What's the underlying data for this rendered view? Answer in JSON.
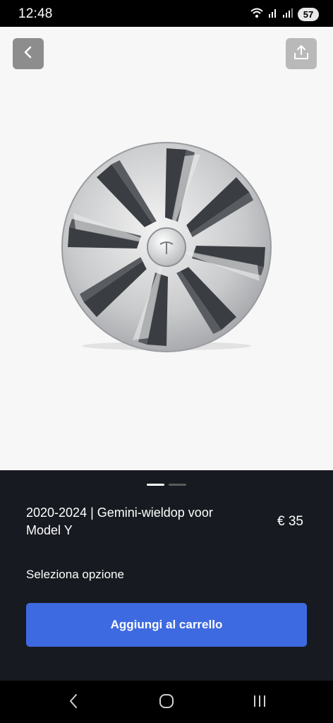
{
  "status_bar": {
    "time": "12:48",
    "battery": "57",
    "icons": [
      "wifi-icon",
      "signal-icon",
      "signal-icon-2"
    ]
  },
  "toolbar": {
    "back_icon": "chevron-left-icon",
    "share_icon": "share-icon"
  },
  "product": {
    "image": "gemini-hubcap",
    "carousel_pages": 2,
    "carousel_active": 1,
    "title": "2020-2024 | Gemini-wieldop voor Model Y",
    "price": "€ 35",
    "option_label": "Seleziona opzione",
    "add_to_cart": "Aggiungi al carrello"
  },
  "navigation": {
    "icons": [
      "back-nav-icon",
      "home-nav-icon",
      "recents-nav-icon"
    ]
  },
  "colors": {
    "panel": "#171a20",
    "accent": "#3e6ae1",
    "image_bg": "#f7f7f7"
  }
}
